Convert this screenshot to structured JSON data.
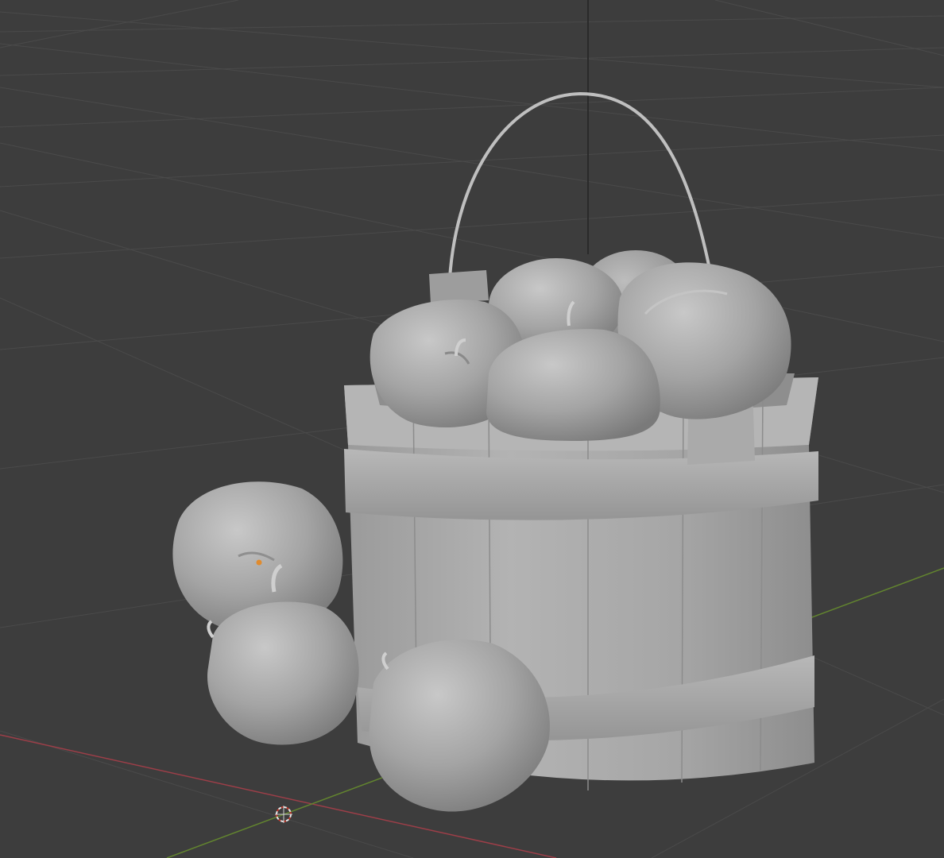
{
  "viewport": {
    "mode": "3D Viewport",
    "shading": "solid",
    "background_color": "#3d3d3d",
    "grid_color": "#4a4a4a",
    "axis_x_color": "#9c3e48",
    "axis_y_color": "#62842f",
    "axis_z_color": "#2a2a2a",
    "origin_marker_color": "#e08b2e",
    "model_color": "#a9a9a9"
  },
  "scene": {
    "objects": [
      "bucket-body",
      "bucket-handle",
      "apple-in-bucket-left",
      "apple-in-bucket-back-center",
      "apple-in-bucket-back-right",
      "apple-in-bucket-right",
      "apple-in-bucket-front",
      "apple-ground-left",
      "apple-ground-front-left",
      "apple-ground-front-right"
    ]
  }
}
